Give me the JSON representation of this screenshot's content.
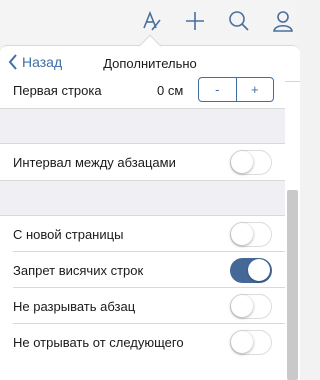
{
  "toolbar": {
    "icons": [
      "text-format-icon",
      "add-icon",
      "search-icon",
      "user-icon"
    ]
  },
  "popover": {
    "back_label": "Назад",
    "title": "Дополнительно",
    "first_line": {
      "label": "Первая строка",
      "value": "0 см",
      "minus": "-",
      "plus": "+"
    },
    "spacing": {
      "label": "Интервал между абзацами",
      "on": false
    },
    "page_break": {
      "label": "С новой страницы",
      "on": false
    },
    "orphan_control": {
      "label": "Запрет висячих строк",
      "on": true
    },
    "keep_together": {
      "label": "Не разрывать абзац",
      "on": false
    },
    "keep_with_next": {
      "label": "Не отрывать от следующего",
      "on": false
    }
  },
  "colors": {
    "accent": "#3f6ea8",
    "toggle_on": "#446997",
    "separator_bg": "#efeff4"
  }
}
